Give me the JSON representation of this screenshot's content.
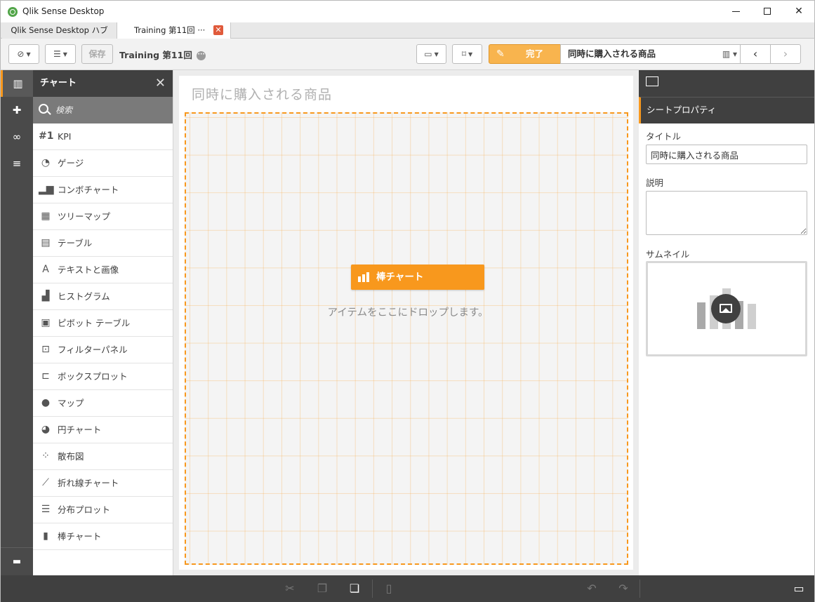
{
  "window": {
    "title": "Qlik Sense Desktop",
    "minimize": "",
    "maximize": "",
    "close": "✕"
  },
  "tabs": [
    {
      "label": "Qlik Sense Desktop ハブ"
    },
    {
      "label": "Training 第11回 ···",
      "close": "✕"
    }
  ],
  "toolbar": {
    "save_label": "保存",
    "app_name": "Training 第11回",
    "info_glyph": "···",
    "done_label": "完了",
    "sheet_title": "同時に購入される商品",
    "prev": "‹",
    "next": "›"
  },
  "assets": {
    "header": "チャート",
    "search_placeholder": "検索",
    "items": [
      {
        "icon": "#1",
        "label": "KPI"
      },
      {
        "icon": "◔",
        "label": "ゲージ"
      },
      {
        "icon": "▂▆",
        "label": "コンボチャート"
      },
      {
        "icon": "▦",
        "label": "ツリーマップ"
      },
      {
        "icon": "▤",
        "label": "テーブル"
      },
      {
        "icon": "A",
        "label": "テキストと画像"
      },
      {
        "icon": "▟",
        "label": "ヒストグラム"
      },
      {
        "icon": "▣",
        "label": "ピボット テーブル"
      },
      {
        "icon": "⊡",
        "label": "フィルターパネル"
      },
      {
        "icon": "⊏",
        "label": "ボックスプロット"
      },
      {
        "icon": "●",
        "label": "マップ"
      },
      {
        "icon": "◕",
        "label": "円チャート"
      },
      {
        "icon": "⁘",
        "label": "散布図"
      },
      {
        "icon": "⟋",
        "label": "折れ線チャート"
      },
      {
        "icon": "☰",
        "label": "分布プロット"
      },
      {
        "icon": "▮",
        "label": "棒チャート"
      }
    ]
  },
  "canvas": {
    "sheet_title": "同時に購入される商品",
    "drag_chip_label": "棒チャート",
    "drop_hint": "アイテムをここにドロップします。"
  },
  "properties": {
    "section": "シートプロパティ",
    "title_label": "タイトル",
    "title_value": "同時に購入される商品",
    "description_label": "説明",
    "description_value": "",
    "thumbnail_label": "サムネイル"
  },
  "colors": {
    "accent": "#f8981d",
    "dark_panel": "#404040",
    "done_button": "#f8b44e"
  }
}
